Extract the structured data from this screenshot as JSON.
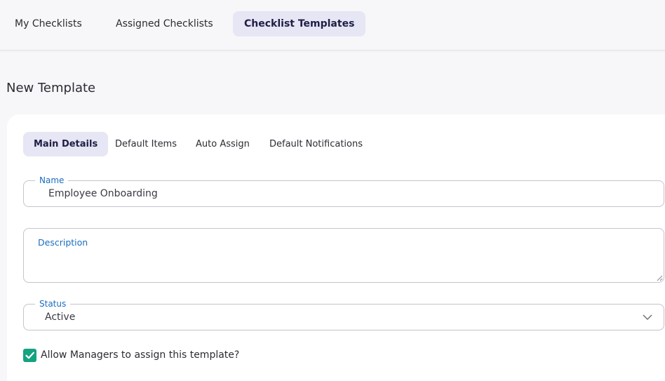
{
  "top_tabs": [
    {
      "label": "My Checklists"
    },
    {
      "label": "Assigned Checklists"
    },
    {
      "label": "Checklist Templates"
    }
  ],
  "page_title": "New Template",
  "sub_tabs": [
    {
      "label": "Main Details"
    },
    {
      "label": "Default Items"
    },
    {
      "label": "Auto Assign"
    },
    {
      "label": "Default Notifications"
    }
  ],
  "form": {
    "name": {
      "label": "Name",
      "value": "Employee Onboarding"
    },
    "description": {
      "label": "Description",
      "value": ""
    },
    "status": {
      "label": "Status",
      "value": "Active"
    },
    "allow_managers": {
      "label": "Allow Managers to assign this template?",
      "checked": true
    }
  },
  "colors": {
    "accent": "#14a37f",
    "active_tab_bg": "#e6e6f4",
    "field_label": "#1a6dbf"
  }
}
